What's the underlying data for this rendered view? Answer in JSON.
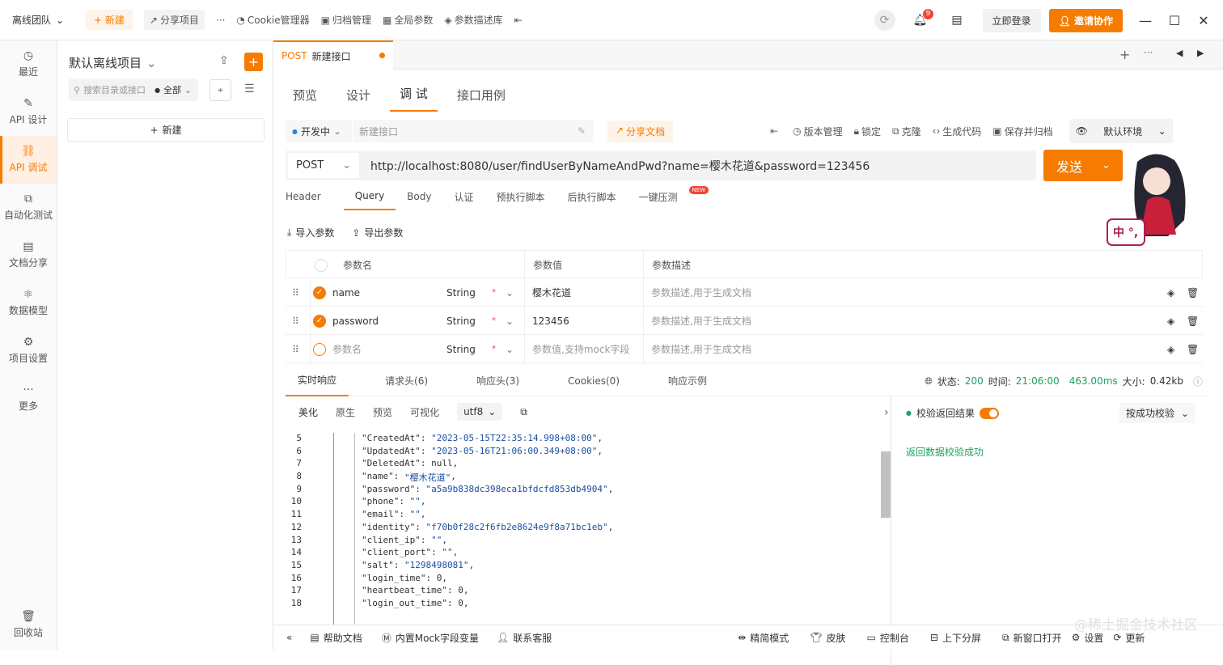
{
  "colors": {
    "accent": "#f57c00",
    "status_ok": "#20a162",
    "badge": "#f04438"
  },
  "topbar": {
    "team": "离线团队",
    "new": "+ 新建",
    "share_project": "分享项目",
    "more": "···",
    "cookie_manager": "Cookie管理器",
    "archive_manager": "归档管理",
    "global_params": "全局参数",
    "param_desc_lib": "参数描述库",
    "notify_count": "9",
    "login": "立即登录",
    "invite": "邀请协作"
  },
  "sidebar": {
    "items": [
      {
        "label": "最近",
        "icon": "clock-icon"
      },
      {
        "label": "API 设计",
        "icon": "edit-icon"
      },
      {
        "label": "API 调试",
        "icon": "link-icon"
      },
      {
        "label": "自动化测试",
        "icon": "flow-icon"
      },
      {
        "label": "文档分享",
        "icon": "doc-icon"
      },
      {
        "label": "数据模型",
        "icon": "model-icon"
      },
      {
        "label": "项目设置",
        "icon": "settings-icon"
      },
      {
        "label": "更多",
        "icon": "more-icon"
      }
    ],
    "recycle": "回收站"
  },
  "project": {
    "title": "默认离线项目",
    "search_placeholder": "搜索目录或接口",
    "filter": "全部",
    "new_label": "新建"
  },
  "request_tab": {
    "method": "POST",
    "name": "新建接口"
  },
  "subtabs": [
    "预览",
    "设计",
    "调 试",
    "接口用例"
  ],
  "toolbar": {
    "status": "开发中",
    "name_placeholder": "新建接口",
    "share_doc": "分享文档",
    "version": "版本管理",
    "lock": "锁定",
    "clone": "克隆",
    "gen_code": "生成代码",
    "save_archive": "保存并归档",
    "env": "默认环境"
  },
  "request": {
    "method": "POST",
    "url": "http://localhost:8080/user/findUserByNameAndPwd?name=樱木花道&password=123456",
    "send": "发送"
  },
  "req_tabs": [
    "Header",
    "Query",
    "Body",
    "认证",
    "预执行脚本",
    "后执行脚本",
    "一键压测"
  ],
  "new_badge": "NEW",
  "params_actions": {
    "import": "导入参数",
    "export": "导出参数"
  },
  "params_table": {
    "headers": [
      "参数名",
      "参数值",
      "参数描述"
    ],
    "rows": [
      {
        "name": "name",
        "type": "String",
        "required": "*",
        "value": "樱木花道",
        "desc": "参数描述,用于生成文档",
        "checked": true
      },
      {
        "name": "password",
        "type": "String",
        "required": "*",
        "value": "123456",
        "desc": "参数描述,用于生成文档",
        "checked": true
      },
      {
        "name": "参数名",
        "type": "String",
        "required": "*",
        "value": "参数值,支持mock字段",
        "desc": "参数描述,用于生成文档",
        "checked": false
      }
    ]
  },
  "response": {
    "tabs": [
      "实时响应",
      "请求头(6)",
      "响应头(3)",
      "Cookies(0)",
      "响应示例"
    ],
    "status_label": "状态:",
    "status": "200",
    "time_label": "时间:",
    "time": "21:06:00",
    "duration": "463.00ms",
    "size_label": "大小:",
    "size": "0.42kb",
    "view_tabs": [
      "美化",
      "原生",
      "预览",
      "可视化"
    ],
    "encoding": "utf8",
    "validate_label": "校验返回结果",
    "validate_mode": "按成功校验",
    "validate_result": "返回数据校验成功"
  },
  "code_lines": [
    {
      "n": "5",
      "k": "\"CreatedAt\"",
      "v": "\"2023-05-15T22:35:14.998+08:00\"",
      "t": "str"
    },
    {
      "n": "6",
      "k": "\"UpdatedAt\"",
      "v": "\"2023-05-16T21:06:00.349+08:00\"",
      "t": "str"
    },
    {
      "n": "7",
      "k": "\"DeletedAt\"",
      "v": "null",
      "t": "num"
    },
    {
      "n": "8",
      "k": "\"name\"",
      "v": "\"樱木花道\"",
      "t": "str"
    },
    {
      "n": "9",
      "k": "\"password\"",
      "v": "\"a5a9b838dc398eca1bfdcfd853db4904\"",
      "t": "str"
    },
    {
      "n": "10",
      "k": "\"phone\"",
      "v": "\"\"",
      "t": "str"
    },
    {
      "n": "11",
      "k": "\"email\"",
      "v": "\"\"",
      "t": "str"
    },
    {
      "n": "12",
      "k": "\"identity\"",
      "v": "\"f70b0f28c2f6fb2e8624e9f8a71bc1eb\"",
      "t": "str"
    },
    {
      "n": "13",
      "k": "\"client_ip\"",
      "v": "\"\"",
      "t": "str"
    },
    {
      "n": "14",
      "k": "\"client_port\"",
      "v": "\"\"",
      "t": "str"
    },
    {
      "n": "15",
      "k": "\"salt\"",
      "v": "\"1298498081\"",
      "t": "str"
    },
    {
      "n": "16",
      "k": "\"login_time\"",
      "v": "0",
      "t": "num"
    },
    {
      "n": "17",
      "k": "\"heartbeat_time\"",
      "v": "0",
      "t": "num"
    },
    {
      "n": "18",
      "k": "\"login_out_time\"",
      "v": "0",
      "t": "num"
    }
  ],
  "bottombar": {
    "help": "帮助文档",
    "mock": "内置Mock字段变量",
    "service": "联系客服",
    "simple": "精简模式",
    "skin": "皮肤",
    "console": "控制台",
    "split": "上下分屏",
    "new_window": "新窗口打开",
    "settings": "设置",
    "update": "更新"
  },
  "watermark": "@稀土掘金技术社区",
  "mascot_text": "中 °,"
}
